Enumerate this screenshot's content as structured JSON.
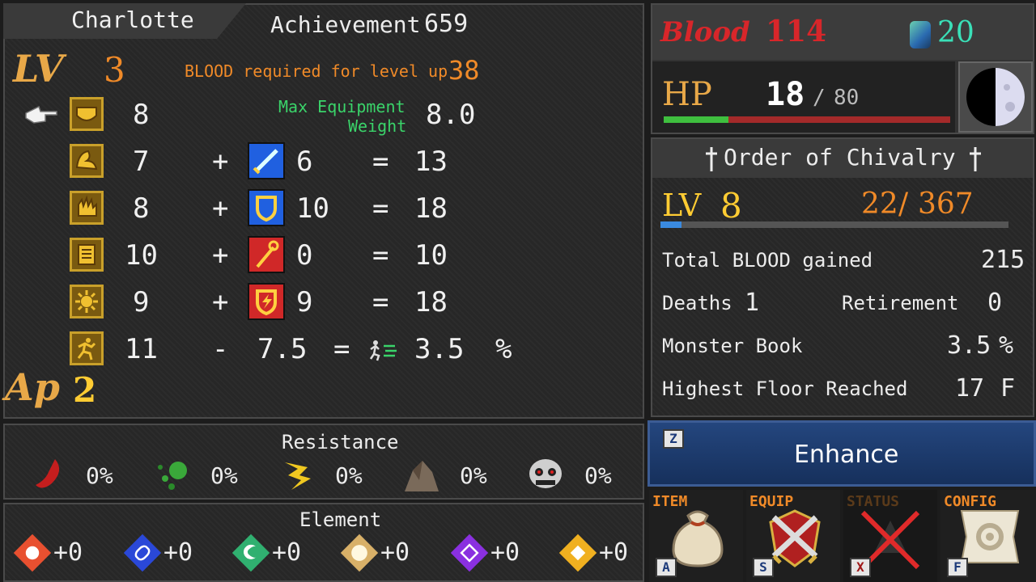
{
  "character": {
    "name": "Charlotte",
    "achievement_label": "Achievement",
    "achievement_value": "659",
    "lv_label": "LV",
    "level": "3",
    "blood_required_label": "BLOOD required for level up",
    "blood_required_value": "38",
    "max_equip_label_line1": "Max Equipment",
    "max_equip_label_line2": "Weight",
    "max_equip_value": "8.0",
    "ap_label": "Ap",
    "ap_value": "2"
  },
  "stats": [
    {
      "icon": "heart-stat-icon",
      "base": "8"
    },
    {
      "icon": "strength-stat-icon",
      "base": "7",
      "op": "+",
      "equip_icon": "sword-icon",
      "equip_color": "#2060e0",
      "bonus": "6",
      "eq": "=",
      "total": "13"
    },
    {
      "icon": "hand-stat-icon",
      "base": "8",
      "op": "+",
      "equip_icon": "shield-icon",
      "equip_color": "#2060e0",
      "bonus": "10",
      "eq": "=",
      "total": "18"
    },
    {
      "icon": "book-stat-icon",
      "base": "10",
      "op": "+",
      "equip_icon": "staff-icon",
      "equip_color": "#d02828",
      "bonus": "0",
      "eq": "=",
      "total": "10"
    },
    {
      "icon": "sun-stat-icon",
      "base": "9",
      "op": "+",
      "equip_icon": "magic-shield-icon",
      "equip_color": "#d02828",
      "bonus": "9",
      "eq": "=",
      "total": "18"
    }
  ],
  "speed_row": {
    "base": "11",
    "op": "-",
    "penalty": "7.5",
    "eq": "=",
    "result": "3.5",
    "unit": "%"
  },
  "resistance": {
    "title": "Resistance",
    "items": [
      {
        "icon": "blood-drop-icon",
        "value": "0%"
      },
      {
        "icon": "poison-icon",
        "value": "0%"
      },
      {
        "icon": "lightning-icon",
        "value": "0%"
      },
      {
        "icon": "rock-icon",
        "value": "0%"
      },
      {
        "icon": "skull-icon",
        "value": "0%"
      }
    ]
  },
  "element": {
    "title": "Element",
    "items": [
      {
        "icon": "fire-element-icon",
        "color": "#e85030",
        "value": "+0"
      },
      {
        "icon": "water-element-icon",
        "color": "#2a48d8",
        "value": "+0"
      },
      {
        "icon": "wind-element-icon",
        "color": "#30b070",
        "value": "+0"
      },
      {
        "icon": "earth-element-icon",
        "color": "#d8b068",
        "value": "+0"
      },
      {
        "icon": "dark-element-icon",
        "color": "#8a30e0",
        "value": "+0"
      },
      {
        "icon": "light-element-icon",
        "color": "#f0b020",
        "value": "+0"
      }
    ]
  },
  "top_right": {
    "blood_label": "Blood",
    "blood_value": "114",
    "gem_value": "20",
    "hp_label": "HP",
    "hp_current": "18",
    "hp_sep": "/",
    "hp_max": "80",
    "hp_fraction": 0.225
  },
  "order": {
    "title": "Order of Chivalry",
    "lv_label": "LV",
    "level": "8",
    "xp_current": "22",
    "xp_sep": "/",
    "xp_max": "367",
    "xp_fraction": 0.06,
    "rows": {
      "total_blood_label": "Total BLOOD gained",
      "total_blood_value": "215",
      "deaths_label": "Deaths",
      "deaths_value": "1",
      "retirement_label": "Retirement",
      "retirement_value": "0",
      "monster_book_label": "Monster Book",
      "monster_book_value": "3.5",
      "monster_book_unit": "%",
      "highest_floor_label": "Highest Floor Reached",
      "highest_floor_value": "17",
      "highest_floor_unit": "F"
    }
  },
  "enhance": {
    "key": "Z",
    "label": "Enhance"
  },
  "menu": [
    {
      "label": "ITEM",
      "key": "A",
      "icon": "bag-icon"
    },
    {
      "label": "EQUIP",
      "key": "S",
      "icon": "crossed-swords-icon"
    },
    {
      "label": "STATUS",
      "key": "X",
      "icon": "status-disabled-icon"
    },
    {
      "label": "CONFIG",
      "key": "F",
      "icon": "gear-scroll-icon"
    }
  ],
  "colors": {
    "accent_orange": "#f08a28",
    "gold": "#ffcc33",
    "blood_red": "#d8262a",
    "hp_green": "#3fbf3f",
    "enhance_blue": "#1c3a6e"
  }
}
